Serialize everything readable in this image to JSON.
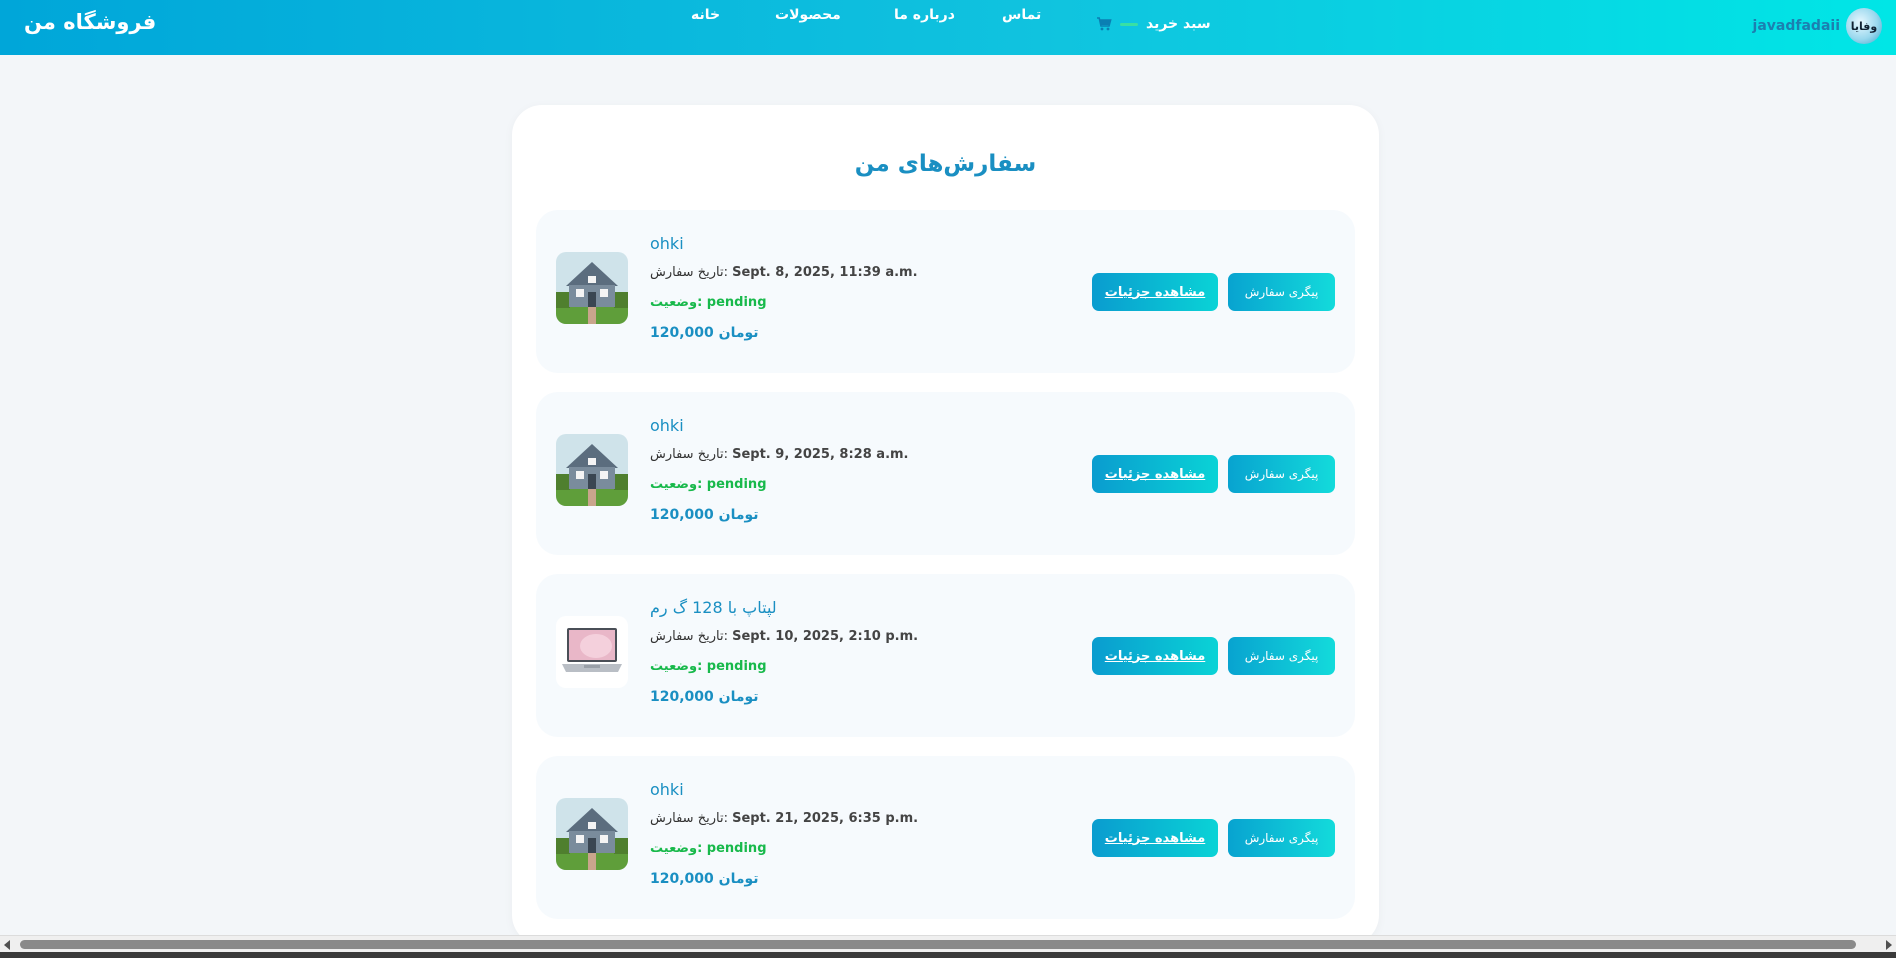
{
  "header": {
    "brand": "فروشگاه من",
    "nav": {
      "home": "خانه",
      "products": "محصولات",
      "about": "درباره ما",
      "contact": "تماس"
    },
    "cart_label": "سبد خرید",
    "username": "javadfadaii",
    "avatar_text": "وفایا"
  },
  "page": {
    "title": "سفارش‌های من"
  },
  "orders": [
    {
      "product_name": "ohki",
      "date_label": "تاریخ سفارش:",
      "date_value": "Sept. 8, 2025, 11:39 a.m.",
      "status_label": "وضعیت:",
      "status_value": "pending",
      "price": "120,000 تومان",
      "image_icon": "house-image",
      "details_label": "مشاهده جزئیات",
      "track_label": "پیگری سفارش"
    },
    {
      "product_name": "ohki",
      "date_label": "تاریخ سفارش:",
      "date_value": "Sept. 9, 2025, 8:28 a.m.",
      "status_label": "وضعیت:",
      "status_value": "pending",
      "price": "120,000 تومان",
      "image_icon": "house-image",
      "details_label": "مشاهده جزئیات",
      "track_label": "پیگری سفارش"
    },
    {
      "product_name": "لپتاپ با 128 گ رم",
      "date_label": "تاریخ سفارش:",
      "date_value": "Sept. 10, 2025, 2:10 p.m.",
      "status_label": "وضعیت:",
      "status_value": "pending",
      "price": "120,000 تومان",
      "image_icon": "laptop-image",
      "details_label": "مشاهده جزئیات",
      "track_label": "پیگری سفارش"
    },
    {
      "product_name": "ohki",
      "date_label": "تاریخ سفارش:",
      "date_value": "Sept. 21, 2025, 6:35 p.m.",
      "status_label": "وضعیت:",
      "status_value": "pending",
      "price": "120,000 تومان",
      "image_icon": "house-image",
      "details_label": "مشاهده جزئیات",
      "track_label": "پیگری سفارش"
    }
  ],
  "colors": {
    "header_gradient_start": "#00a6d9",
    "header_gradient_end": "#00e6e6",
    "accent": "#1a8fc2",
    "status_pending": "#18b94b",
    "page_background": "#f3f6f9"
  }
}
